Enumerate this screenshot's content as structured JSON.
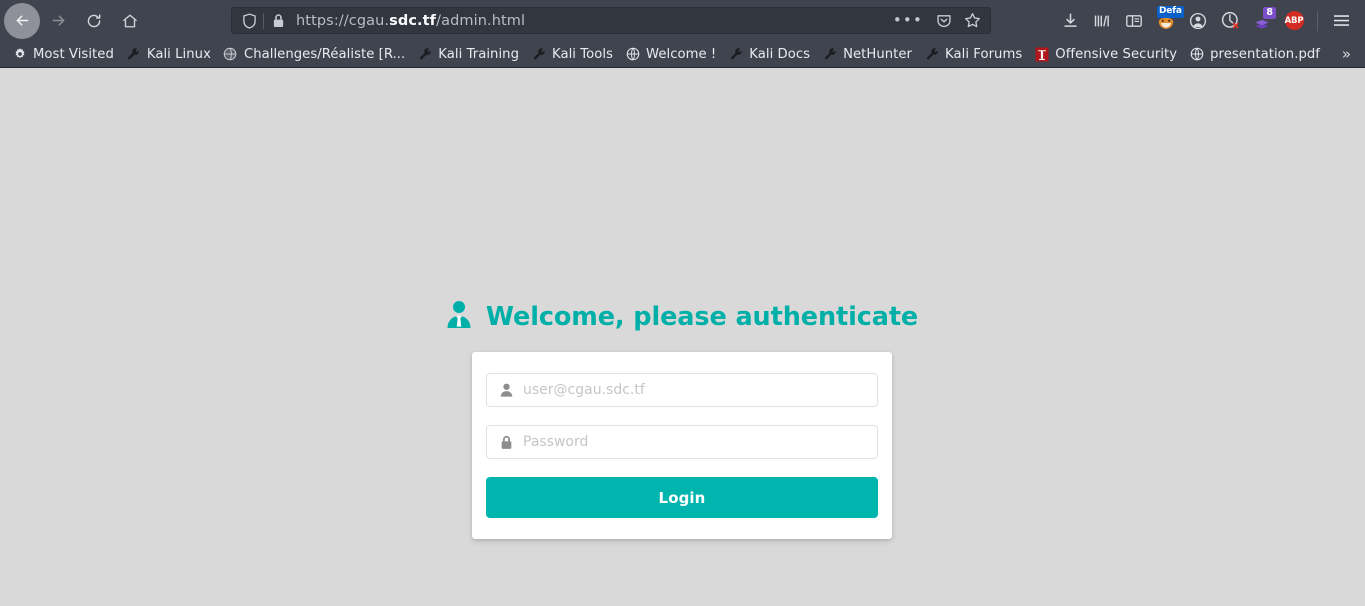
{
  "browser": {
    "nav": {
      "back_tooltip": "Back",
      "forward_tooltip": "Forward",
      "reload_tooltip": "Reload",
      "home_tooltip": "Home"
    },
    "urlbar": {
      "url_prefix": "https://cgau.",
      "url_host": "sdc.tf",
      "url_suffix": "/admin.html",
      "full_url": "https://cgau.sdc.tf/admin.html",
      "shield_icon": "tracking-protection-shield-icon",
      "lock_icon": "padlock-icon",
      "page_actions": "ellipsis-icon",
      "pocket_icon": "pocket-icon",
      "bookmark_icon": "star-icon"
    },
    "toolbar_right": [
      {
        "name": "downloads-icon",
        "label": ""
      },
      {
        "name": "library-icon",
        "label": ""
      },
      {
        "name": "sidebar-icon",
        "label": ""
      },
      {
        "name": "foxyproxy-icon",
        "label": "",
        "badge": "Defa"
      },
      {
        "name": "account-icon",
        "label": ""
      },
      {
        "name": "noscript-icon",
        "label": ""
      },
      {
        "name": "cookie-quick-manager-icon",
        "label": "",
        "badge": "8"
      },
      {
        "name": "adblock-plus-icon",
        "label": "ABP"
      },
      {
        "name": "app-menu-icon",
        "label": ""
      }
    ],
    "bookmarks": [
      {
        "label": "Most Visited",
        "icon": "gear-icon"
      },
      {
        "label": "Kali Linux",
        "icon": "wrench-icon"
      },
      {
        "label": "Challenges/Réaliste [R...",
        "icon": "globe-dark-icon"
      },
      {
        "label": "Kali Training",
        "icon": "wrench-icon"
      },
      {
        "label": "Kali Tools",
        "icon": "wrench-icon"
      },
      {
        "label": "Welcome !",
        "icon": "globe-icon"
      },
      {
        "label": "Kali Docs",
        "icon": "wrench-icon"
      },
      {
        "label": "NetHunter",
        "icon": "wrench-icon"
      },
      {
        "label": "Kali Forums",
        "icon": "wrench-icon"
      },
      {
        "label": "Offensive Security",
        "icon": "offsec-icon"
      },
      {
        "label": "presentation.pdf",
        "icon": "globe-icon"
      }
    ],
    "bookmarks_overflow": "»"
  },
  "page": {
    "heading": "Welcome, please authenticate",
    "heading_icon": "user-tie-icon",
    "username": {
      "placeholder": "user@cgau.sdc.tf",
      "value": "",
      "icon": "user-icon"
    },
    "password": {
      "placeholder": "Password",
      "value": "",
      "icon": "lock-icon"
    },
    "login_label": "Login",
    "colors": {
      "accent": "#00b5ad",
      "heading": "#00b0a8",
      "page_bg": "#d9d9d9",
      "card_bg": "#ffffff",
      "chrome_bg": "#3f444e"
    }
  }
}
